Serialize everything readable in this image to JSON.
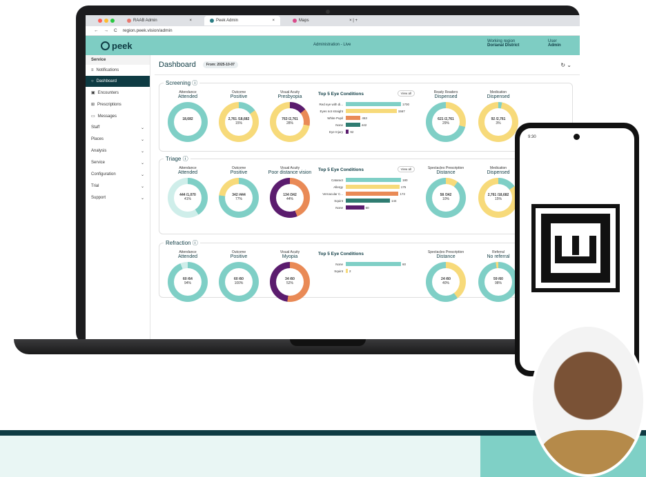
{
  "browser": {
    "tabs": [
      {
        "label": "RAAB Admin",
        "color": "#e8776d"
      },
      {
        "label": "Peek Admin",
        "color": "#2a7d84"
      },
      {
        "label": "Maps",
        "color": "#d94a8a"
      }
    ],
    "url": "region.peek.vision/admin"
  },
  "app": {
    "logo": "peek",
    "center_title": "Administration - Live",
    "working_region_label": "Working region",
    "working_region_value": "Dorianal District",
    "user_label": "User",
    "user_value": "Admin"
  },
  "sidebar": {
    "section": "Service",
    "items": [
      "Notifications",
      "Dashboard",
      "Encounters",
      "Prescriptions",
      "Messages"
    ],
    "groups": [
      "Staff",
      "Places",
      "Analysis",
      "Service",
      "Configuration",
      "Trial",
      "Support"
    ]
  },
  "dashboard": {
    "title": "Dashboard",
    "from_pill": "From: 2025-10-07",
    "sections": [
      {
        "title": "Screening",
        "cards": [
          {
            "l1": "Attendance",
            "l2": "Attended",
            "value": "18,682",
            "pct": ""
          },
          {
            "l1": "Outcome",
            "l2": "Positive",
            "value": "2,761 /18,682",
            "pct": "15%"
          },
          {
            "l1": "Visual Acuity",
            "l2": "Presbyopia",
            "value": "763 /2,761",
            "pct": "28%"
          },
          {
            "l1": "Ready Readers",
            "l2": "Dispensed",
            "value": "621 /2,761",
            "pct": "29%"
          },
          {
            "l1": "Medication",
            "l2": "Dispensed",
            "value": "92 /2,761",
            "pct": "3%"
          }
        ],
        "bars": [
          {
            "label": "Red eye with di...",
            "value": 1700
          },
          {
            "label": "Eyes not straight",
            "value": 1567
          },
          {
            "label": "White Pupil",
            "value": 453
          },
          {
            "label": "None",
            "value": 442
          },
          {
            "label": "Eye Injury",
            "value": 92
          }
        ]
      },
      {
        "title": "Triage",
        "cards": [
          {
            "l1": "Attendance",
            "l2": "Attended",
            "value": "444 /1,070",
            "pct": "41%"
          },
          {
            "l1": "Outcome",
            "l2": "Positive",
            "value": "342 /444",
            "pct": "77%"
          },
          {
            "l1": "Visual Acuity",
            "l2": "Poor distance vision",
            "value": "134 /342",
            "pct": "44%"
          },
          {
            "l1": "Spectacles Prescription",
            "l2": "Distance",
            "value": "58 /342",
            "pct": "10%"
          },
          {
            "l1": "Medication",
            "l2": "Dispensed",
            "value": "2,761 /18,682",
            "pct": "15%"
          }
        ],
        "bars": [
          {
            "label": "Cataract",
            "value": 180
          },
          {
            "label": "Allergy",
            "value": 175
          },
          {
            "label": "Vernacular C...",
            "value": 172
          },
          {
            "label": "Squint",
            "value": 144
          },
          {
            "label": "None",
            "value": 60
          }
        ]
      },
      {
        "title": "Refraction",
        "cards": [
          {
            "l1": "Attendance",
            "l2": "Attended",
            "value": "60 /64",
            "pct": "94%"
          },
          {
            "l1": "Outcome",
            "l2": "Positive",
            "value": "60 /60",
            "pct": "100%"
          },
          {
            "l1": "Visual Acuity",
            "l2": "Myopia",
            "value": "34 /60",
            "pct": "52%"
          },
          {
            "l1": "Spectacles Prescription",
            "l2": "Distance",
            "value": "24 /60",
            "pct": "40%"
          },
          {
            "l1": "Referral",
            "l2": "No referral",
            "value": "59 /60",
            "pct": "98%"
          }
        ],
        "bars": [
          {
            "label": "None",
            "value": 60
          },
          {
            "label": "Squint",
            "value": 2
          }
        ]
      }
    ],
    "bar_title": "Top 5 Eye Conditions",
    "view_all": "View all",
    "colors": {
      "teal": "#7fcfc6",
      "yellow": "#f7da7a",
      "orange": "#e98a56",
      "green": "#2f7c71",
      "purple": "#5b1c6e"
    }
  },
  "phone": {
    "time": "9:30"
  }
}
